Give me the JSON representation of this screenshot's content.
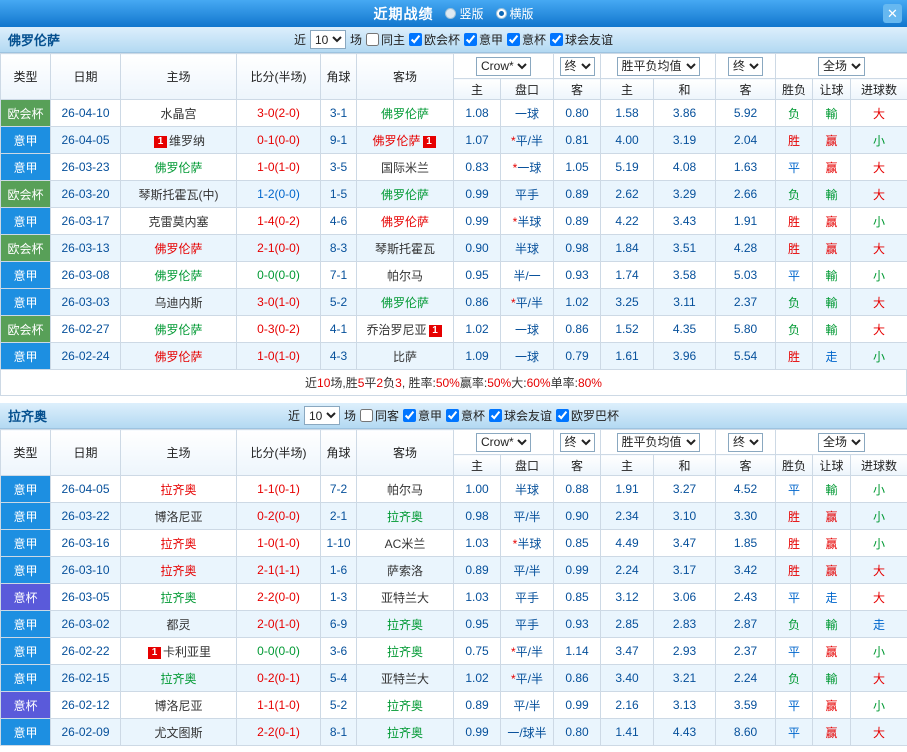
{
  "palette": {
    "red": "#e60000",
    "green": "#009933",
    "blue": "#0066cc",
    "black": "#333333"
  },
  "titlebar": {
    "title": "近期战绩",
    "radio_vertical": "竖版",
    "radio_horizontal": "横版",
    "selected_mode": "横版",
    "close_glyph": "✕"
  },
  "columns": {
    "main": [
      "类型",
      "日期",
      "主场",
      "比分(半场)",
      "角球",
      "客场"
    ],
    "sub": [
      "主",
      "盘口",
      "客",
      "主",
      "和",
      "客",
      "胜负",
      "让球",
      "进球数"
    ]
  },
  "dropdowns": [
    "Crow*",
    "终",
    "胜平负均值",
    "终",
    "全场"
  ],
  "sections": [
    {
      "team": "佛罗伦萨",
      "near_label": "近",
      "games": "10",
      "games_suffix": "场",
      "filters": [
        {
          "label": "同主",
          "checked": false
        },
        {
          "label": "欧会杯",
          "checked": true
        },
        {
          "label": "意甲",
          "checked": true
        },
        {
          "label": "意杯",
          "checked": true
        },
        {
          "label": "球会友谊",
          "checked": true
        }
      ],
      "rows": [
        {
          "type": "欧会杯",
          "tc": "g",
          "date": "26-04-10",
          "home": {
            "n": "水晶宫",
            "c": "k"
          },
          "score": {
            "t": "3-0(2-0)",
            "c": "r"
          },
          "corner": "3-1",
          "away": {
            "n": "佛罗伦萨",
            "c": "g"
          },
          "o": [
            "1.08",
            "一球",
            "0.80"
          ],
          "e": [
            "1.58",
            "3.86",
            "5.92"
          ],
          "r": [
            [
              "负",
              "g"
            ],
            [
              "輸",
              "g"
            ],
            [
              "大",
              "r"
            ]
          ]
        },
        {
          "type": "意甲",
          "tc": "b",
          "date": "26-04-05",
          "home": {
            "n": "维罗纳",
            "c": "k",
            "b1": "1"
          },
          "score": {
            "t": "0-1(0-0)",
            "c": "r"
          },
          "corner": "9-1",
          "away": {
            "n": "佛罗伦萨",
            "c": "r",
            "b2": "1"
          },
          "o": [
            "1.07",
            "*平/半",
            "0.81"
          ],
          "e": [
            "4.00",
            "3.19",
            "2.04"
          ],
          "r": [
            [
              "胜",
              "r"
            ],
            [
              "赢",
              "r"
            ],
            [
              "小",
              "g"
            ]
          ]
        },
        {
          "type": "意甲",
          "tc": "b",
          "date": "26-03-23",
          "home": {
            "n": "佛罗伦萨",
            "c": "g"
          },
          "score": {
            "t": "1-0(1-0)",
            "c": "r"
          },
          "corner": "3-5",
          "away": {
            "n": "国际米兰",
            "c": "k"
          },
          "o": [
            "0.83",
            "*一球",
            "1.05"
          ],
          "e": [
            "5.19",
            "4.08",
            "1.63"
          ],
          "r": [
            [
              "平",
              "b"
            ],
            [
              "赢",
              "r"
            ],
            [
              "大",
              "r"
            ]
          ]
        },
        {
          "type": "欧会杯",
          "tc": "g",
          "date": "26-03-20",
          "home": {
            "n": "琴斯托霍瓦(中)",
            "c": "k"
          },
          "score": {
            "t": "1-2(0-0)",
            "c": "b"
          },
          "corner": "1-5",
          "away": {
            "n": "佛罗伦萨",
            "c": "g"
          },
          "o": [
            "0.99",
            "平手",
            "0.89"
          ],
          "e": [
            "2.62",
            "3.29",
            "2.66"
          ],
          "r": [
            [
              "负",
              "g"
            ],
            [
              "輸",
              "g"
            ],
            [
              "大",
              "r"
            ]
          ]
        },
        {
          "type": "意甲",
          "tc": "b",
          "date": "26-03-17",
          "home": {
            "n": "克雷莫内塞",
            "c": "k"
          },
          "score": {
            "t": "1-4(0-2)",
            "c": "r"
          },
          "corner": "4-6",
          "away": {
            "n": "佛罗伦萨",
            "c": "r"
          },
          "o": [
            "0.99",
            "*半球",
            "0.89"
          ],
          "e": [
            "4.22",
            "3.43",
            "1.91"
          ],
          "r": [
            [
              "胜",
              "r"
            ],
            [
              "赢",
              "r"
            ],
            [
              "小",
              "g"
            ]
          ]
        },
        {
          "type": "欧会杯",
          "tc": "g",
          "date": "26-03-13",
          "home": {
            "n": "佛罗伦萨",
            "c": "r"
          },
          "score": {
            "t": "2-1(0-0)",
            "c": "r"
          },
          "corner": "8-3",
          "away": {
            "n": "琴斯托霍瓦",
            "c": "k"
          },
          "o": [
            "0.90",
            "半球",
            "0.98"
          ],
          "e": [
            "1.84",
            "3.51",
            "4.28"
          ],
          "r": [
            [
              "胜",
              "r"
            ],
            [
              "赢",
              "r"
            ],
            [
              "大",
              "r"
            ]
          ]
        },
        {
          "type": "意甲",
          "tc": "b",
          "date": "26-03-08",
          "home": {
            "n": "佛罗伦萨",
            "c": "g"
          },
          "score": {
            "t": "0-0(0-0)",
            "c": "g"
          },
          "corner": "7-1",
          "away": {
            "n": "帕尔马",
            "c": "k"
          },
          "o": [
            "0.95",
            "半/一",
            "0.93"
          ],
          "e": [
            "1.74",
            "3.58",
            "5.03"
          ],
          "r": [
            [
              "平",
              "b"
            ],
            [
              "輸",
              "g"
            ],
            [
              "小",
              "g"
            ]
          ]
        },
        {
          "type": "意甲",
          "tc": "b",
          "date": "26-03-03",
          "home": {
            "n": "乌迪内斯",
            "c": "k"
          },
          "score": {
            "t": "3-0(1-0)",
            "c": "r"
          },
          "corner": "5-2",
          "away": {
            "n": "佛罗伦萨",
            "c": "g"
          },
          "o": [
            "0.86",
            "*平/半",
            "1.02"
          ],
          "e": [
            "3.25",
            "3.11",
            "2.37"
          ],
          "r": [
            [
              "负",
              "g"
            ],
            [
              "輸",
              "g"
            ],
            [
              "大",
              "r"
            ]
          ]
        },
        {
          "type": "欧会杯",
          "tc": "g",
          "date": "26-02-27",
          "home": {
            "n": "佛罗伦萨",
            "c": "g"
          },
          "score": {
            "t": "0-3(0-2)",
            "c": "r"
          },
          "corner": "4-1",
          "away": {
            "n": "乔治罗尼亚",
            "c": "k",
            "b2": "1"
          },
          "o": [
            "1.02",
            "一球",
            "0.86"
          ],
          "e": [
            "1.52",
            "4.35",
            "5.80"
          ],
          "r": [
            [
              "负",
              "g"
            ],
            [
              "輸",
              "g"
            ],
            [
              "大",
              "r"
            ]
          ]
        },
        {
          "type": "意甲",
          "tc": "b",
          "date": "26-02-24",
          "home": {
            "n": "佛罗伦萨",
            "c": "r"
          },
          "score": {
            "t": "1-0(1-0)",
            "c": "r"
          },
          "corner": "4-3",
          "away": {
            "n": "比萨",
            "c": "k"
          },
          "o": [
            "1.09",
            "一球",
            "0.79"
          ],
          "e": [
            "1.61",
            "3.96",
            "5.54"
          ],
          "r": [
            [
              "胜",
              "r"
            ],
            [
              "走",
              "b"
            ],
            [
              "小",
              "g"
            ]
          ]
        }
      ],
      "summary": [
        {
          "t": "近",
          "c": "k"
        },
        {
          "t": "10",
          "c": "r"
        },
        {
          "t": "场,胜",
          "c": "k"
        },
        {
          "t": "5",
          "c": "r"
        },
        {
          "t": "平",
          "c": "k"
        },
        {
          "t": "2",
          "c": "r"
        },
        {
          "t": "负",
          "c": "k"
        },
        {
          "t": "3",
          "c": "r"
        },
        {
          "t": ", 胜率:",
          "c": "k"
        },
        {
          "t": "50%",
          "c": "r"
        },
        {
          "t": " 赢率:",
          "c": "k"
        },
        {
          "t": "50%",
          "c": "r"
        },
        {
          "t": " 大:",
          "c": "k"
        },
        {
          "t": "60%",
          "c": "r"
        },
        {
          "t": " 单率:",
          "c": "k"
        },
        {
          "t": "80%",
          "c": "r"
        }
      ]
    },
    {
      "team": "拉齐奥",
      "near_label": "近",
      "games": "10",
      "games_suffix": "场",
      "filters": [
        {
          "label": "同客",
          "checked": false
        },
        {
          "label": "意甲",
          "checked": true
        },
        {
          "label": "意杯",
          "checked": true
        },
        {
          "label": "球会友谊",
          "checked": true
        },
        {
          "label": "欧罗巴杯",
          "checked": true
        }
      ],
      "rows": [
        {
          "type": "意甲",
          "tc": "b",
          "date": "26-04-05",
          "home": {
            "n": "拉齐奥",
            "c": "r"
          },
          "score": {
            "t": "1-1(0-1)",
            "c": "r"
          },
          "corner": "7-2",
          "away": {
            "n": "帕尔马",
            "c": "k"
          },
          "o": [
            "1.00",
            "半球",
            "0.88"
          ],
          "e": [
            "1.91",
            "3.27",
            "4.52"
          ],
          "r": [
            [
              "平",
              "b"
            ],
            [
              "輸",
              "g"
            ],
            [
              "小",
              "g"
            ]
          ]
        },
        {
          "type": "意甲",
          "tc": "b",
          "date": "26-03-22",
          "home": {
            "n": "博洛尼亚",
            "c": "k"
          },
          "score": {
            "t": "0-2(0-0)",
            "c": "r"
          },
          "corner": "2-1",
          "away": {
            "n": "拉齐奥",
            "c": "g"
          },
          "o": [
            "0.98",
            "平/半",
            "0.90"
          ],
          "e": [
            "2.34",
            "3.10",
            "3.30"
          ],
          "r": [
            [
              "胜",
              "r"
            ],
            [
              "赢",
              "r"
            ],
            [
              "小",
              "g"
            ]
          ]
        },
        {
          "type": "意甲",
          "tc": "b",
          "date": "26-03-16",
          "home": {
            "n": "拉齐奥",
            "c": "r"
          },
          "score": {
            "t": "1-0(1-0)",
            "c": "r"
          },
          "corner": "1-10",
          "away": {
            "n": "AC米兰",
            "c": "k"
          },
          "o": [
            "1.03",
            "*半球",
            "0.85"
          ],
          "e": [
            "4.49",
            "3.47",
            "1.85"
          ],
          "r": [
            [
              "胜",
              "r"
            ],
            [
              "赢",
              "r"
            ],
            [
              "小",
              "g"
            ]
          ]
        },
        {
          "type": "意甲",
          "tc": "b",
          "date": "26-03-10",
          "home": {
            "n": "拉齐奥",
            "c": "r"
          },
          "score": {
            "t": "2-1(1-1)",
            "c": "r"
          },
          "corner": "1-6",
          "away": {
            "n": "萨索洛",
            "c": "k"
          },
          "o": [
            "0.89",
            "平/半",
            "0.99"
          ],
          "e": [
            "2.24",
            "3.17",
            "3.42"
          ],
          "r": [
            [
              "胜",
              "r"
            ],
            [
              "赢",
              "r"
            ],
            [
              "大",
              "r"
            ]
          ]
        },
        {
          "type": "意杯",
          "tc": "p",
          "date": "26-03-05",
          "home": {
            "n": "拉齐奥",
            "c": "g"
          },
          "score": {
            "t": "2-2(0-0)",
            "c": "r"
          },
          "corner": "1-3",
          "away": {
            "n": "亚特兰大",
            "c": "k"
          },
          "o": [
            "1.03",
            "平手",
            "0.85"
          ],
          "e": [
            "3.12",
            "3.06",
            "2.43"
          ],
          "r": [
            [
              "平",
              "b"
            ],
            [
              "走",
              "b"
            ],
            [
              "大",
              "r"
            ]
          ]
        },
        {
          "type": "意甲",
          "tc": "b",
          "date": "26-03-02",
          "home": {
            "n": "都灵",
            "c": "k"
          },
          "score": {
            "t": "2-0(1-0)",
            "c": "r"
          },
          "corner": "6-9",
          "away": {
            "n": "拉齐奥",
            "c": "g"
          },
          "o": [
            "0.95",
            "平手",
            "0.93"
          ],
          "e": [
            "2.85",
            "2.83",
            "2.87"
          ],
          "r": [
            [
              "负",
              "g"
            ],
            [
              "輸",
              "g"
            ],
            [
              "走",
              "b"
            ]
          ]
        },
        {
          "type": "意甲",
          "tc": "b",
          "date": "26-02-22",
          "home": {
            "n": "卡利亚里",
            "c": "k",
            "b1": "1"
          },
          "score": {
            "t": "0-0(0-0)",
            "c": "g"
          },
          "corner": "3-6",
          "away": {
            "n": "拉齐奥",
            "c": "g"
          },
          "o": [
            "0.75",
            "*平/半",
            "1.14"
          ],
          "e": [
            "3.47",
            "2.93",
            "2.37"
          ],
          "r": [
            [
              "平",
              "b"
            ],
            [
              "赢",
              "r"
            ],
            [
              "小",
              "g"
            ]
          ]
        },
        {
          "type": "意甲",
          "tc": "b",
          "date": "26-02-15",
          "home": {
            "n": "拉齐奥",
            "c": "g"
          },
          "score": {
            "t": "0-2(0-1)",
            "c": "r"
          },
          "corner": "5-4",
          "away": {
            "n": "亚特兰大",
            "c": "k"
          },
          "o": [
            "1.02",
            "*平/半",
            "0.86"
          ],
          "e": [
            "3.40",
            "3.21",
            "2.24"
          ],
          "r": [
            [
              "负",
              "g"
            ],
            [
              "輸",
              "g"
            ],
            [
              "大",
              "r"
            ]
          ]
        },
        {
          "type": "意杯",
          "tc": "p",
          "date": "26-02-12",
          "home": {
            "n": "博洛尼亚",
            "c": "k"
          },
          "score": {
            "t": "1-1(1-0)",
            "c": "r"
          },
          "corner": "5-2",
          "away": {
            "n": "拉齐奥",
            "c": "g"
          },
          "o": [
            "0.89",
            "平/半",
            "0.99"
          ],
          "e": [
            "2.16",
            "3.13",
            "3.59"
          ],
          "r": [
            [
              "平",
              "b"
            ],
            [
              "赢",
              "r"
            ],
            [
              "小",
              "g"
            ]
          ]
        },
        {
          "type": "意甲",
          "tc": "b",
          "date": "26-02-09",
          "home": {
            "n": "尤文图斯",
            "c": "k"
          },
          "score": {
            "t": "2-2(0-1)",
            "c": "r"
          },
          "corner": "8-1",
          "away": {
            "n": "拉齐奥",
            "c": "g"
          },
          "o": [
            "0.99",
            "一/球半",
            "0.80"
          ],
          "e": [
            "1.41",
            "4.43",
            "8.60"
          ],
          "r": [
            [
              "平",
              "b"
            ],
            [
              "赢",
              "r"
            ],
            [
              "大",
              "r"
            ]
          ]
        }
      ],
      "summary": null
    }
  ]
}
